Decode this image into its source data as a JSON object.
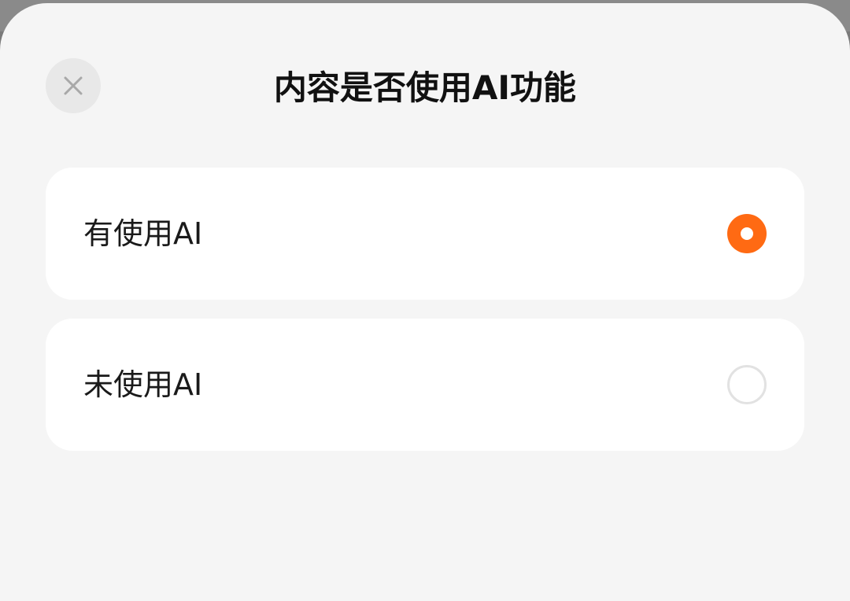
{
  "dialog": {
    "title": "内容是否使用AI功能",
    "close_icon": "close-icon"
  },
  "options": [
    {
      "label": "有使用AI",
      "selected": true
    },
    {
      "label": "未使用AI",
      "selected": false
    }
  ],
  "colors": {
    "accent": "#ff6a13",
    "sheet_background": "#f5f5f5",
    "card_background": "#ffffff"
  }
}
